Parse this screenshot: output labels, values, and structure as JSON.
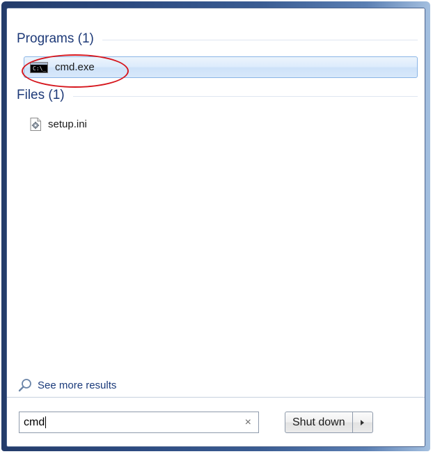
{
  "groups": [
    {
      "title": "Programs (1)",
      "items": [
        {
          "label": "cmd.exe",
          "icon": "cmd-icon",
          "selected": true
        }
      ]
    },
    {
      "title": "Files (1)",
      "items": [
        {
          "label": "setup.ini",
          "icon": "ini-file-icon",
          "selected": false
        }
      ]
    }
  ],
  "cmd_icon_text": "C:\\_",
  "see_more": {
    "label": "See more results",
    "icon": "search-icon"
  },
  "search": {
    "value": "cmd",
    "clear_symbol": "×"
  },
  "shutdown": {
    "label": "Shut down",
    "arrow_icon": "triangle-right-icon"
  },
  "colors": {
    "group_title": "#1e3a78",
    "selection_border": "#89b4e6",
    "highlight_ellipse": "#d6161d"
  }
}
